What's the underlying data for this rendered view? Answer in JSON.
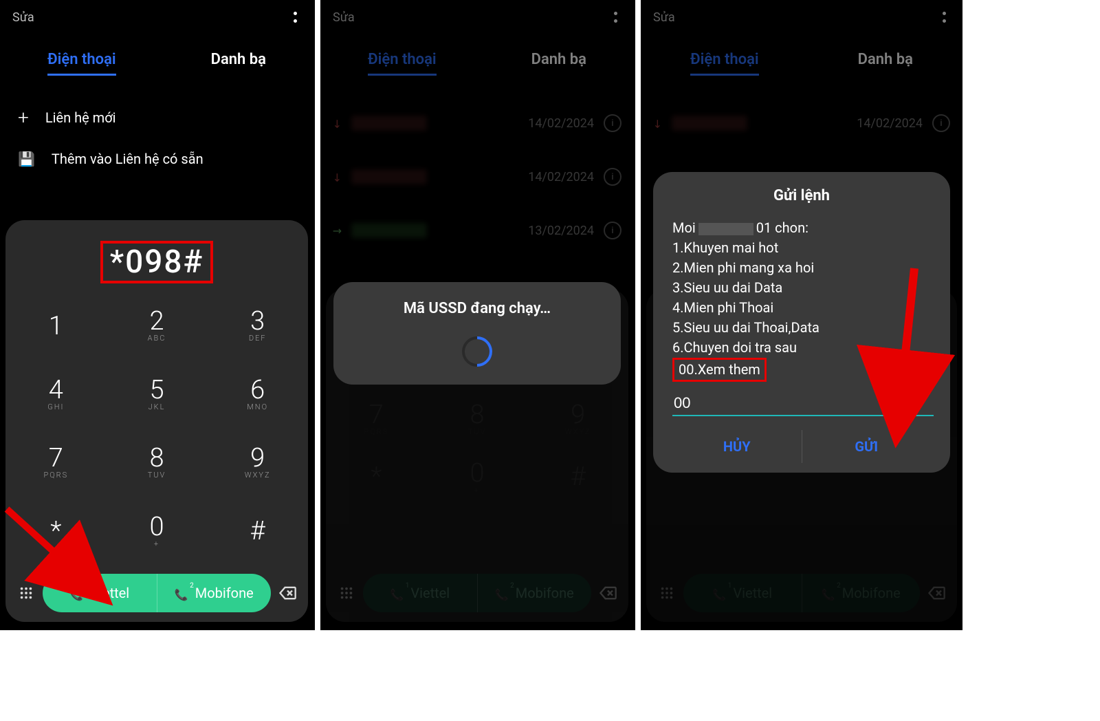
{
  "common": {
    "sua": "Sửa",
    "tab_phone": "Điện thoại",
    "tab_contacts": "Danh bạ",
    "sim1": "Viettel",
    "sim2": "Mobifone"
  },
  "screen1": {
    "action_new": "Liên hệ mới",
    "action_existing": "Thêm vào Liên hệ có sẵn",
    "dialed": "*098#",
    "keys": {
      "1": {
        "d": "1",
        "s": ""
      },
      "2": {
        "d": "2",
        "s": "ABC"
      },
      "3": {
        "d": "3",
        "s": "DEF"
      },
      "4": {
        "d": "4",
        "s": "GHI"
      },
      "5": {
        "d": "5",
        "s": "JKL"
      },
      "6": {
        "d": "6",
        "s": "MNO"
      },
      "7": {
        "d": "7",
        "s": "PQRS"
      },
      "8": {
        "d": "8",
        "s": "TUV"
      },
      "9": {
        "d": "9",
        "s": "WXYZ"
      },
      "star": {
        "d": "*",
        "s": ""
      },
      "0": {
        "d": "0",
        "s": "+"
      },
      "hash": {
        "d": "#",
        "s": ""
      }
    }
  },
  "screen2": {
    "log": [
      {
        "date": "14/02/2024"
      },
      {
        "date": "14/02/2024"
      },
      {
        "date": "13/02/2024"
      }
    ],
    "ussd_msg": "Mã USSD đang chạy…"
  },
  "screen3": {
    "log": [
      {
        "date": "14/02/2024"
      }
    ],
    "dialog": {
      "title": "Gửi lệnh",
      "line_prefix": "Moi",
      "line_suffix": "01 chon:",
      "options": [
        "1.Khuyen mai hot",
        "2.Mien phi mang xa hoi",
        "3.Sieu uu dai Data",
        "4.Mien phi Thoai",
        "5.Sieu uu dai Thoai,Data",
        "6.Chuyen doi tra sau"
      ],
      "option_boxed": "00.Xem them",
      "input": "00",
      "cancel": "HỦY",
      "send": "GỬI"
    }
  }
}
